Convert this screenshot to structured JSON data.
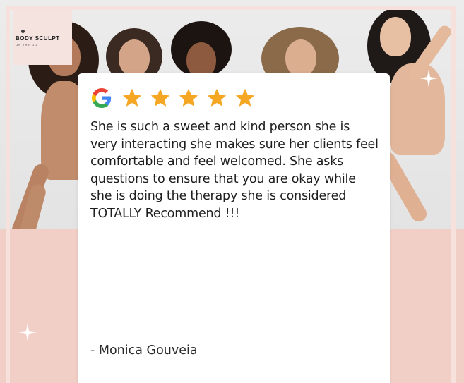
{
  "brand": {
    "name": "BODY SCULPT",
    "tagline": "ON THE GO"
  },
  "review": {
    "source_icon": "google-g-icon",
    "rating": 5,
    "rating_max": 5,
    "text": "She is such a sweet and kind person she is very interacting she makes sure her clients feel comfortable and feel welcomed. She asks questions to ensure that you are okay while she is doing the therapy she is considered TOTALLY Recommend !!!",
    "author": "- Monica Gouveia"
  },
  "colors": {
    "star": "#f5a623",
    "pink_background": "#f2cfc6",
    "card": "#ffffff",
    "text": "#1e1e1e"
  }
}
